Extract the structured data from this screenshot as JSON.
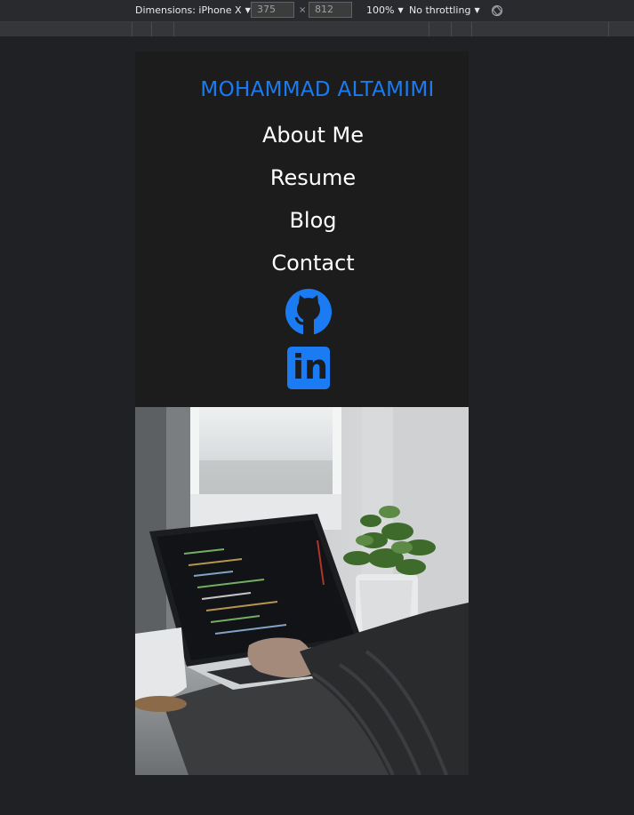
{
  "devtools": {
    "dimensions_label": "Dimensions: iPhone X",
    "width_value": "375",
    "height_value": "812",
    "times_symbol": "×",
    "zoom_label": "100%",
    "throttling_label": "No throttling",
    "caret": "▼"
  },
  "site": {
    "title": "MOHAMMAD ALTAMIMI",
    "nav": [
      {
        "label": "About Me"
      },
      {
        "label": "Resume"
      },
      {
        "label": "Blog"
      },
      {
        "label": "Contact"
      }
    ],
    "social": {
      "github_icon": "github-icon",
      "linkedin_icon": "linkedin-icon",
      "linkedin_text": "in"
    },
    "hero_image": "laptop-coding-photo"
  },
  "colors": {
    "accent": "#1a7bf2",
    "page_bg": "#202124",
    "nav_text": "#ffffff"
  }
}
